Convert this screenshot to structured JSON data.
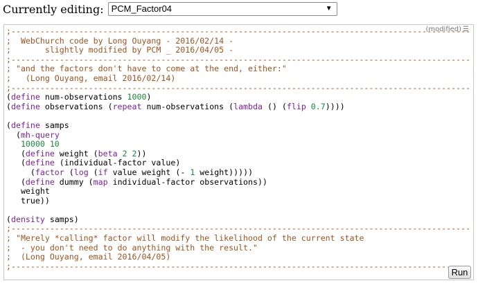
{
  "header": {
    "label": "Currently editing:",
    "selected_program": "PCM_Factor04"
  },
  "editor": {
    "status": "(modified)",
    "menu_icon": "hamburger-icon",
    "run_label": "Run",
    "code_lines": [
      [
        [
          "c",
          ";----------------------------------------------------------------------------------------------------------"
        ]
      ],
      [
        [
          "c",
          ";  WebChurch code by Long Ouyang - 2016/02/14 -"
        ]
      ],
      [
        [
          "c",
          ";       slightly modified by PCM _ 2016/04/05 -"
        ]
      ],
      [
        [
          "c",
          ";----------------------------------------------------------------------------------------------------------"
        ]
      ],
      [
        [
          "c",
          "; \"and the factors don't have to come at the end, either:\""
        ]
      ],
      [
        [
          "c",
          ";   (Long Ouyang, email 2016/02/14)"
        ]
      ],
      [
        [
          "c",
          ";----------------------------------------------------------------------------------------------------------"
        ]
      ],
      [
        [
          "p",
          "("
        ],
        [
          "k",
          "define"
        ],
        [
          "p",
          " num-observations "
        ],
        [
          "n",
          "1000"
        ],
        [
          "p",
          ")"
        ]
      ],
      [
        [
          "p",
          "("
        ],
        [
          "k",
          "define"
        ],
        [
          "p",
          " observations ("
        ],
        [
          "k",
          "repeat"
        ],
        [
          "p",
          " num-observations ("
        ],
        [
          "k",
          "lambda"
        ],
        [
          "p",
          " () ("
        ],
        [
          "k",
          "flip"
        ],
        [
          "p",
          " "
        ],
        [
          "n",
          "0.7"
        ],
        [
          "p",
          "))))"
        ]
      ],
      [
        [
          "p",
          ""
        ]
      ],
      [
        [
          "p",
          "("
        ],
        [
          "k",
          "define"
        ],
        [
          "p",
          " samps"
        ]
      ],
      [
        [
          "p",
          "  ("
        ],
        [
          "k",
          "mh-query"
        ]
      ],
      [
        [
          "n",
          "   10000 10"
        ]
      ],
      [
        [
          "p",
          "   ("
        ],
        [
          "k",
          "define"
        ],
        [
          "p",
          " weight ("
        ],
        [
          "k",
          "beta"
        ],
        [
          "p",
          " "
        ],
        [
          "n",
          "2 2"
        ],
        [
          "p",
          "))"
        ]
      ],
      [
        [
          "p",
          "   ("
        ],
        [
          "k",
          "define"
        ],
        [
          "p",
          " (individual-factor value)"
        ]
      ],
      [
        [
          "p",
          "     ("
        ],
        [
          "k",
          "factor"
        ],
        [
          "p",
          " ("
        ],
        [
          "k",
          "log"
        ],
        [
          "p",
          " ("
        ],
        [
          "k",
          "if"
        ],
        [
          "p",
          " value weight (- "
        ],
        [
          "n",
          "1"
        ],
        [
          "p",
          " weight)))))"
        ]
      ],
      [
        [
          "p",
          "   ("
        ],
        [
          "k",
          "define"
        ],
        [
          "p",
          " dummy ("
        ],
        [
          "k",
          "map"
        ],
        [
          "p",
          " individual-factor observations))"
        ]
      ],
      [
        [
          "p",
          "   weight"
        ]
      ],
      [
        [
          "p",
          "   true))"
        ]
      ],
      [
        [
          "p",
          ""
        ]
      ],
      [
        [
          "p",
          "("
        ],
        [
          "k",
          "density"
        ],
        [
          "p",
          " samps)"
        ]
      ],
      [
        [
          "c",
          ";----------------------------------------------------------------------------------------------------------"
        ]
      ],
      [
        [
          "c",
          "; \"Merely *calling* factor will modify the likelihood of the current state"
        ]
      ],
      [
        [
          "c",
          ";  - you don't need to do anything with the result.\""
        ]
      ],
      [
        [
          "c",
          ";  (Long Ouyang, email 2016/04/05)"
        ]
      ],
      [
        [
          "c",
          ";----------------------------------------------------------------------------------------------------------"
        ]
      ]
    ]
  }
}
